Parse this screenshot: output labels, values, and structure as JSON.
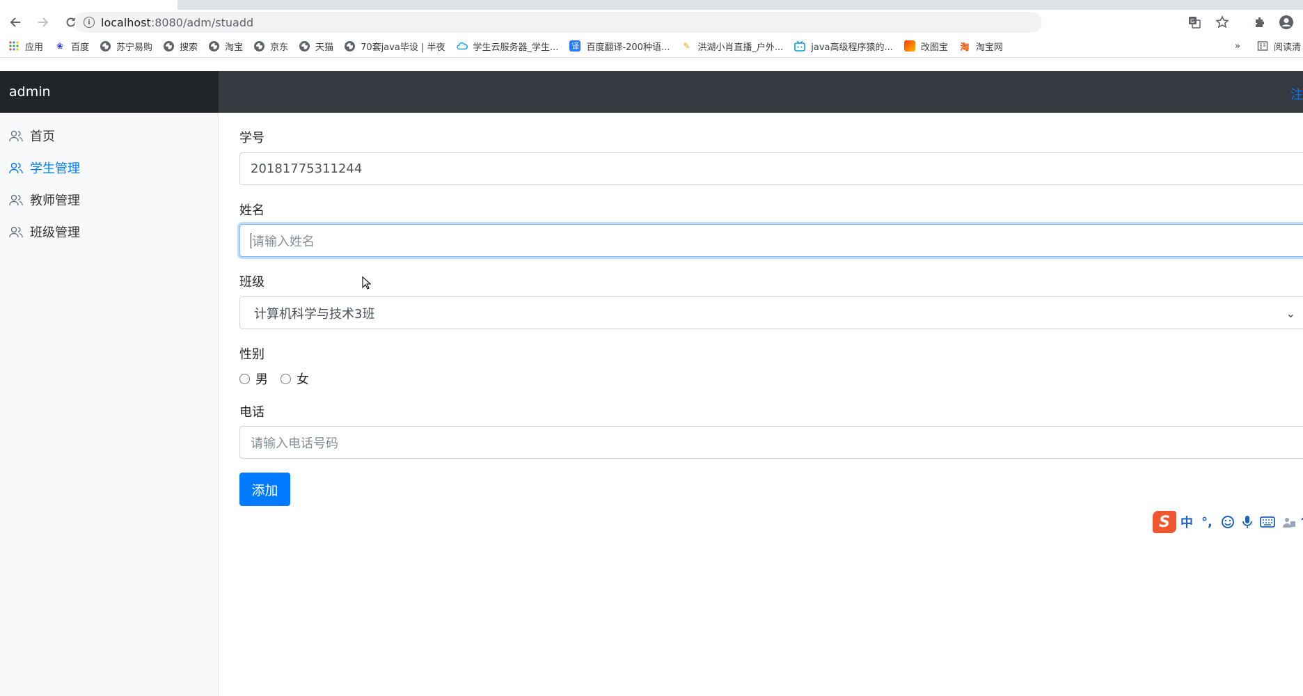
{
  "browser": {
    "url_host": "localhost",
    "url_path": ":8080/adm/stuadd",
    "bookmarks": [
      "应用",
      "百度",
      "苏宁易购",
      "搜索",
      "淘宝",
      "京东",
      "天猫",
      "70套java毕设 | 半夜",
      "学生云服务器_学生...",
      "百度翻译-200种语...",
      "洪湖小肖直播_户外...",
      "java高级程序猿的...",
      "改图宝",
      "淘宝网"
    ],
    "more_bookmarks": "»",
    "reading_list": "阅读清"
  },
  "app": {
    "brand": "admin",
    "logout": "注"
  },
  "sidebar": {
    "items": [
      {
        "label": "首页"
      },
      {
        "label": "学生管理"
      },
      {
        "label": "教师管理"
      },
      {
        "label": "班级管理"
      }
    ]
  },
  "form": {
    "id_label": "学号",
    "id_value": "20181775311244",
    "name_label": "姓名",
    "name_placeholder": "请输入姓名",
    "class_label": "班级",
    "class_value": "计算机科学与技术3班",
    "gender_label": "性别",
    "gender_options": [
      "男",
      "女"
    ],
    "phone_label": "电话",
    "phone_placeholder": "请输入电话号码",
    "submit": "添加"
  },
  "ime": {
    "mode": "中",
    "punct": "°,"
  },
  "colors": {
    "primary": "#007bff",
    "header": "#343a40",
    "brand_bg": "#212529"
  }
}
